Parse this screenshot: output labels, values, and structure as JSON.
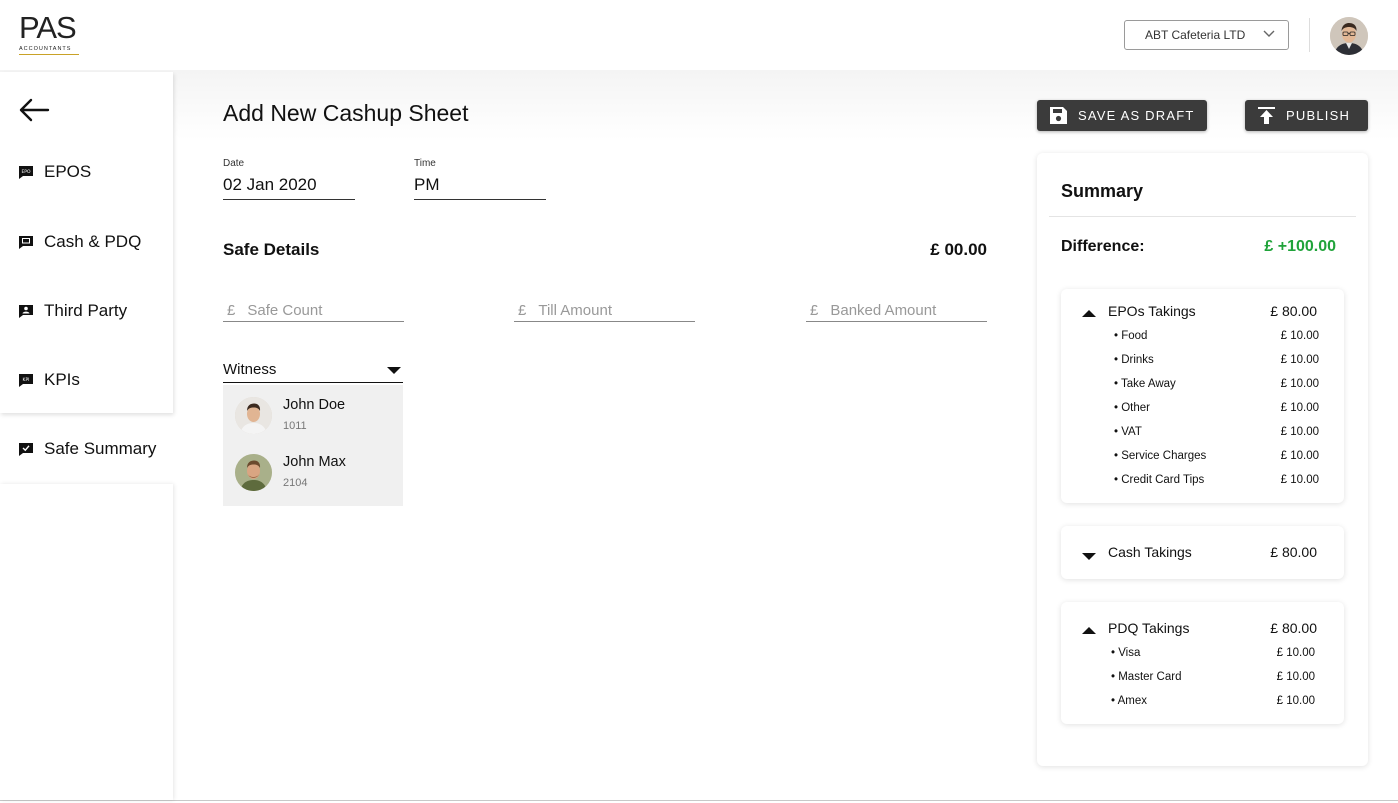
{
  "header": {
    "logo_text": "PAS",
    "logo_sub": "ACCOUNTANTS",
    "company_selector": "ABT Cafeteria LTD"
  },
  "sidebar": {
    "items": [
      {
        "label": "EPOS",
        "icon": "epos-icon"
      },
      {
        "label": "Cash & PDQ",
        "icon": "cash-pdq-icon"
      },
      {
        "label": "Third Party",
        "icon": "third-party-icon"
      },
      {
        "label": "KPIs",
        "icon": "kpi-icon"
      },
      {
        "label": "Safe Summary",
        "icon": "safe-summary-icon"
      }
    ]
  },
  "main": {
    "title": "Add New Cashup Sheet",
    "date": {
      "label": "Date",
      "value": "02 Jan 2020"
    },
    "time": {
      "label": "Time",
      "value": "PM"
    },
    "safe_details": {
      "title": "Safe Details",
      "total": "£ 00.00"
    },
    "inputs": [
      {
        "currency": "£",
        "placeholder": "Safe Count"
      },
      {
        "currency": "£",
        "placeholder": "Till Amount"
      },
      {
        "currency": "£",
        "placeholder": "Banked Amount"
      }
    ],
    "witness": {
      "label": "Witness",
      "options": [
        {
          "name": "John Doe",
          "id": "1011"
        },
        {
          "name": "John Max",
          "id": "2104"
        }
      ]
    }
  },
  "actions": {
    "save_draft": "SAVE AS DRAFT",
    "publish": "PUBLISH"
  },
  "summary": {
    "title": "Summary",
    "difference_label": "Difference:",
    "difference_value": "£ +100.00",
    "difference_color": "#20a33a",
    "cards": [
      {
        "label": "EPOs Takings",
        "amount": "£ 80.00",
        "expanded": true,
        "items": [
          {
            "name": "• Food",
            "amount": "£ 10.00"
          },
          {
            "name": "• Drinks",
            "amount": "£ 10.00"
          },
          {
            "name": "• Take Away",
            "amount": "£ 10.00"
          },
          {
            "name": "• Other",
            "amount": "£ 10.00"
          },
          {
            "name": "• VAT",
            "amount": "£ 10.00"
          },
          {
            "name": "• Service Charges",
            "amount": "£ 10.00"
          },
          {
            "name": "• Credit Card Tips",
            "amount": "£ 10.00"
          }
        ]
      },
      {
        "label": "Cash Takings",
        "amount": "£ 80.00",
        "expanded": false,
        "items": []
      },
      {
        "label": "PDQ Takings",
        "amount": "£ 80.00",
        "expanded": true,
        "items": [
          {
            "name": "• Visa",
            "amount": "£ 10.00"
          },
          {
            "name": "• Master Card",
            "amount": "£ 10.00"
          },
          {
            "name": "• Amex",
            "amount": "£ 10.00"
          }
        ]
      }
    ]
  }
}
